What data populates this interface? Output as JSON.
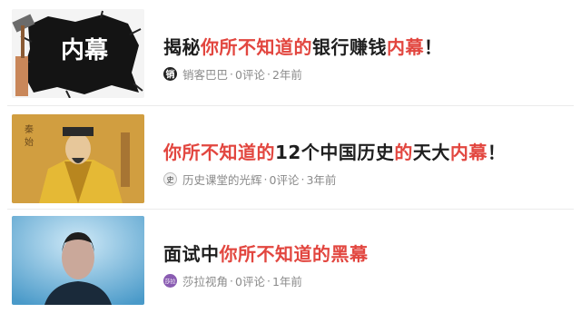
{
  "feed": {
    "items": [
      {
        "title_parts": [
          "揭秘",
          "你所不知道的",
          "银行赚钱",
          "内幕",
          "！"
        ],
        "thumb_label": "内幕",
        "source": "销客巴巴",
        "source_icon": "xiao-logo-icon",
        "comments": "0评论",
        "time": "2年前"
      },
      {
        "title_parts": [
          "你所不知道的",
          "12个中国历史",
          "的",
          "天大",
          "内幕",
          "！"
        ],
        "source": "历史课堂的光辉",
        "source_hot": "的光辉",
        "source_icon": "history-logo-icon",
        "comments": "0评论",
        "time": "3年前"
      },
      {
        "title_parts": [
          "面试中",
          "你所不知道的黑幕"
        ],
        "source": "莎拉视角",
        "source_icon": "shala-logo-icon",
        "comments": "0评论",
        "time": "1年前"
      }
    ]
  },
  "separator": "·",
  "colors": {
    "highlight": "#e2463f",
    "title": "#1f1f1f",
    "meta": "#8a8a8a"
  }
}
